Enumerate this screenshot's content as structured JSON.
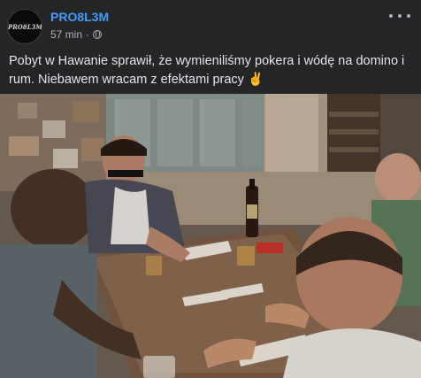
{
  "post": {
    "author": "PRO8L3M",
    "avatar_text": "PRO8L3M",
    "time": "57 min",
    "separator": "·",
    "privacy_icon": "globe-icon",
    "more_icon": "ellipsis-icon",
    "text_line1": "Pobyt w Hawanie sprawił, że wymieniliśmy pokera i wódę na domino i",
    "text_line2": "rum. Niebawem wracam z efektami pracy",
    "emoji": "✌"
  },
  "colors": {
    "background": "#242526",
    "author": "#4599ff",
    "text": "#e4e6eb",
    "meta": "#b0b3b8"
  }
}
